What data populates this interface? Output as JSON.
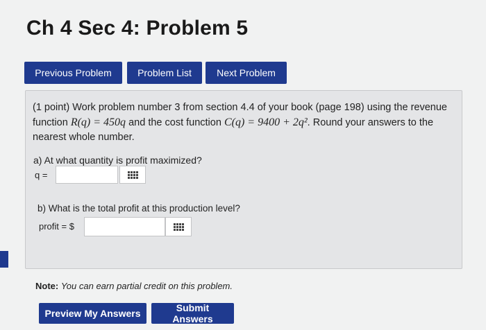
{
  "page": {
    "title": "Ch 4 Sec 4: Problem 5"
  },
  "nav": {
    "previous_label": "Previous Problem",
    "list_label": "Problem List",
    "next_label": "Next Problem"
  },
  "problem": {
    "points": "(1 point)",
    "intro": "Work problem number 3 from section 4.4 of your book (page 198) using the revenue function",
    "revenue_fn": "R(q) = 450q",
    "mid": "and the cost function",
    "cost_fn": "C(q) = 9400 + 2q²",
    "outro": ". Round your answers to the nearest whole number.",
    "part_a": {
      "question": "a) At what quantity is profit maximized?",
      "label": "q =",
      "value": ""
    },
    "part_b": {
      "question": "b) What is the total profit at this production level?",
      "label": "profit = $",
      "value": ""
    }
  },
  "note": {
    "bold": "Note:",
    "text": "You can earn partial credit on this problem."
  },
  "actions": {
    "preview_label": "Preview My Answers",
    "submit_label": "Submit Answers"
  },
  "colors": {
    "button_bg": "#1f3a8f",
    "page_bg": "#f1f2f2",
    "problem_bg": "#e4e5e7"
  },
  "icons": {
    "equation_editor": "equation-keypad-icon"
  }
}
